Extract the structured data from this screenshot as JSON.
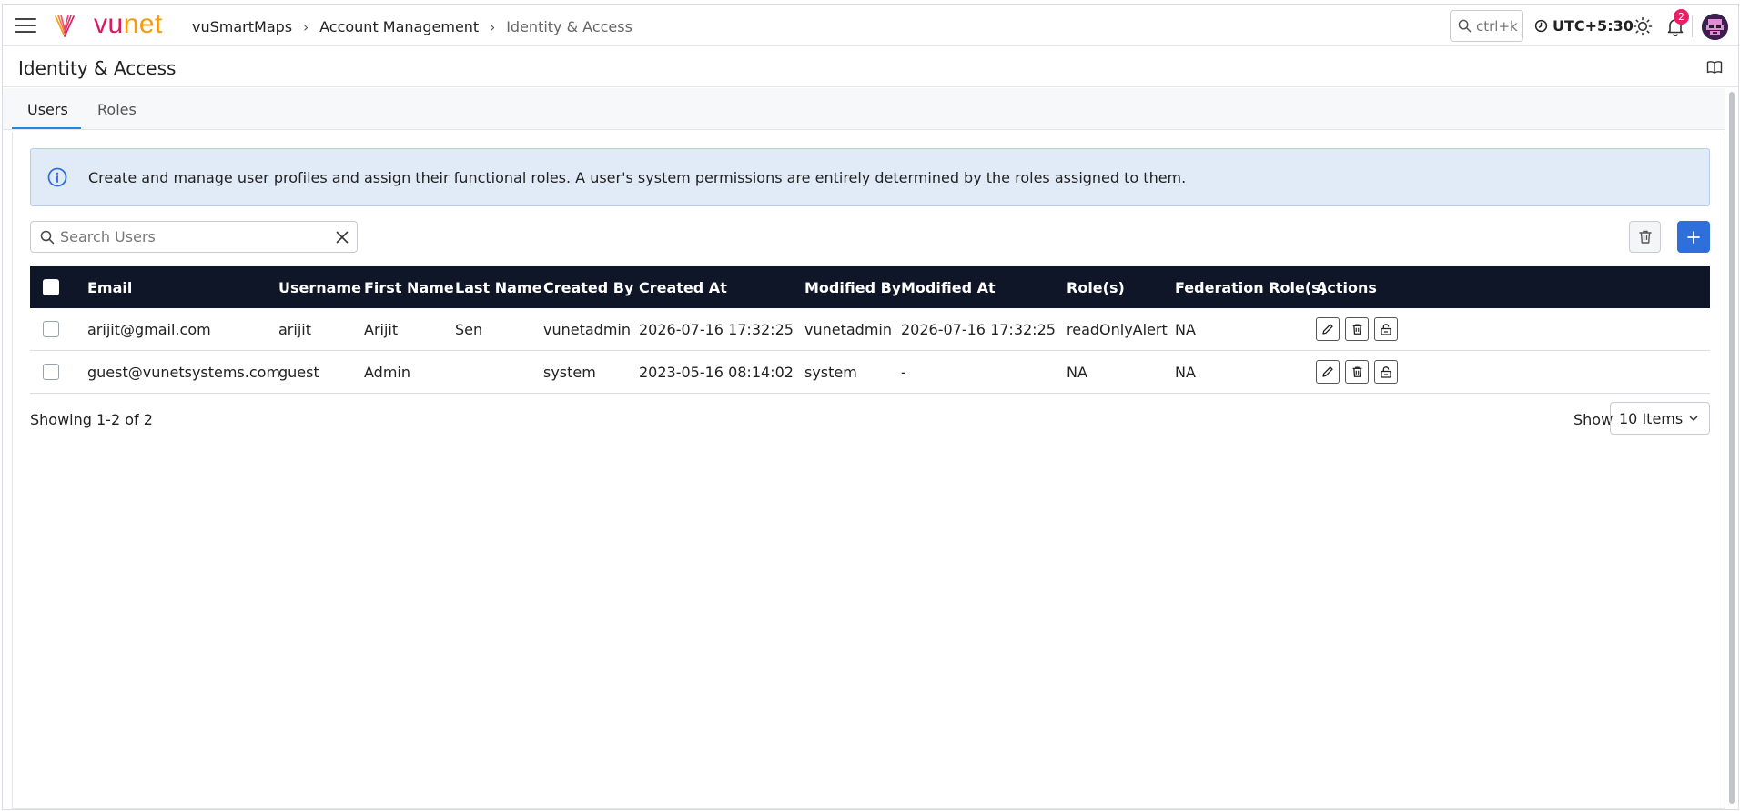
{
  "brand": {
    "logo_vu": "vu",
    "logo_net": "net"
  },
  "breadcrumb": [
    "vuSmartMaps",
    "Account Management",
    "Identity & Access"
  ],
  "topbar": {
    "search_hint": "ctrl+k",
    "timezone": "UTC+5:30",
    "notification_count": "2"
  },
  "page": {
    "title": "Identity & Access"
  },
  "tabs": [
    {
      "label": "Users",
      "active": true
    },
    {
      "label": "Roles",
      "active": false
    }
  ],
  "info_banner": "Create and manage user profiles and assign their functional roles. A user's system permissions are entirely determined by the roles assigned to them.",
  "search": {
    "placeholder": "Search Users",
    "value": ""
  },
  "table": {
    "columns": [
      "Email",
      "Username",
      "First Name",
      "Last Name",
      "Created By",
      "Created At",
      "Modified By",
      "Modified At",
      "Role(s)",
      "Federation Role(s)",
      "Actions"
    ],
    "rows": [
      [
        "arijit@gmail.com",
        "arijit",
        "Arijit",
        "Sen",
        "vunetadmin",
        "2026-07-16 17:32:25",
        "vunetadmin",
        "2026-07-16 17:32:25",
        "readOnlyAlert",
        "NA"
      ],
      [
        "guest@vunetsystems.com",
        "guest",
        "Admin",
        "",
        "system",
        "2023-05-16 08:14:02",
        "system",
        "-",
        "NA",
        "NA"
      ]
    ]
  },
  "pagination": {
    "summary": "Showing 1-2 of 2",
    "show_label": "Show",
    "page_size": "10 Items"
  },
  "colors": {
    "header_bg": "#0f1628",
    "primary": "#2f6fdc",
    "info_bg": "#e1ebf8",
    "tab_accent": "#1e88e5",
    "badge": "#e91e63"
  }
}
